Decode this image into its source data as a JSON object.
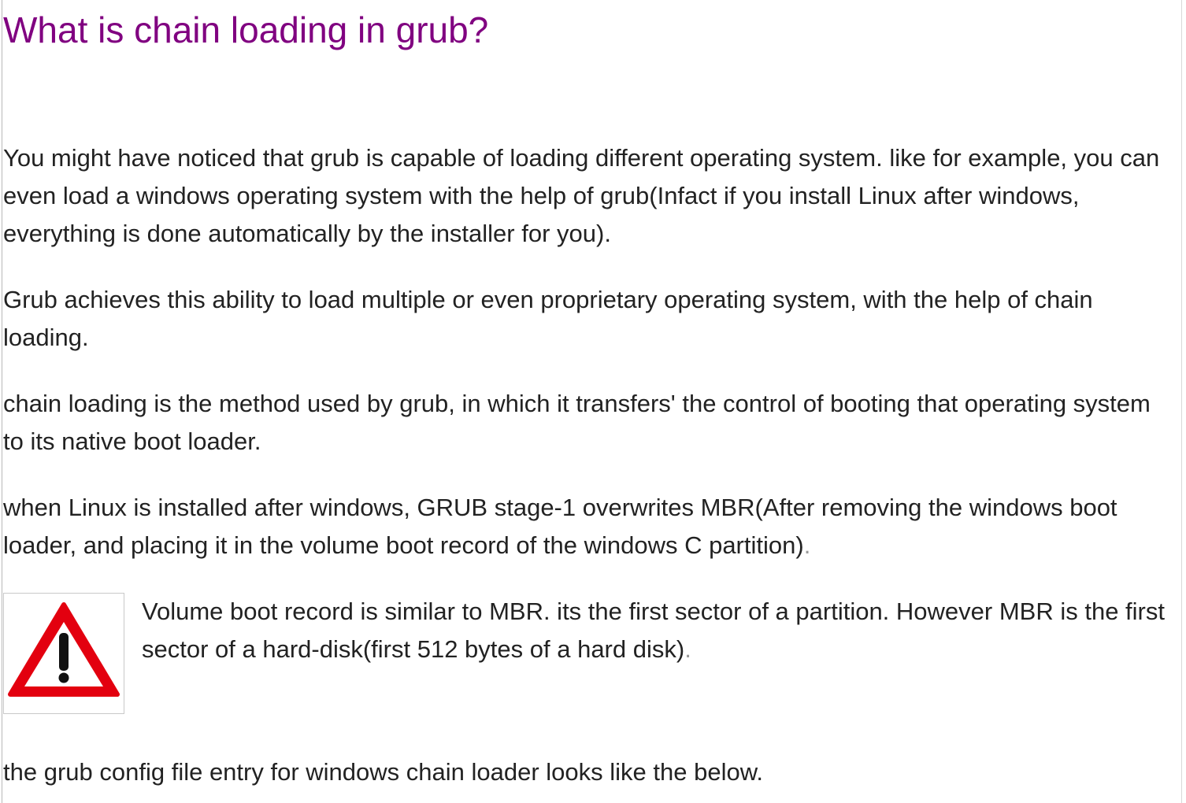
{
  "article": {
    "title": "What is chain loading in grub?",
    "paragraphs": [
      "You might have noticed that grub is capable of loading different operating system. like for example, you can even load a windows operating system with the help of grub(Infact if you install Linux after windows, everything is done automatically by the installer for you).",
      "Grub achieves this ability to load multiple or even proprietary operating system, with the help of chain loading.",
      "chain loading is the method used by grub, in which it transfers' the control of booting that operating system to its native boot loader.",
      "when Linux is installed after windows, GRUB stage-1 overwrites MBR(After removing the windows boot loader, and placing it in the volume boot record of the windows C partition)"
    ],
    "paragraph4_trailing": ".",
    "note": {
      "icon": "warning-triangle-icon",
      "text": "Volume boot record is similar to MBR. its the first sector of a partition. However MBR is the first sector of a hard-disk(first 512 bytes of a hard disk)",
      "trailing": "."
    },
    "closing": "the grub config file entry for windows chain loader looks like the below."
  },
  "colors": {
    "title": "#800080",
    "body_text": "#222222",
    "warning_red": "#e3000f"
  }
}
